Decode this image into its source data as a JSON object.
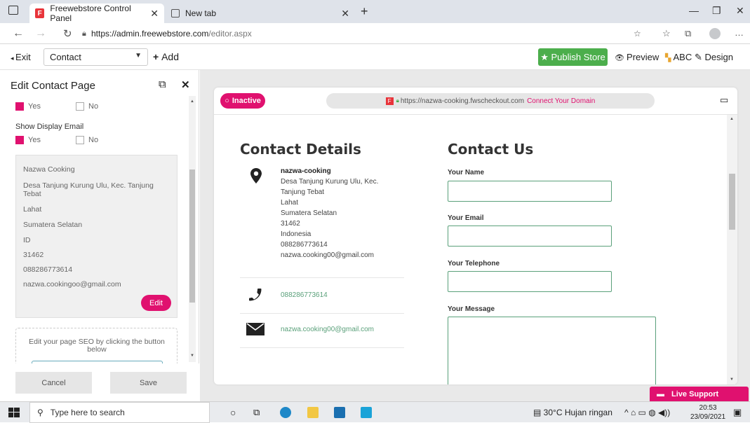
{
  "browser": {
    "tabs": [
      {
        "title": "Freewebstore Control Panel",
        "active": true
      },
      {
        "title": "New tab",
        "active": false
      }
    ],
    "url_host": "https://admin.freewebstore.com",
    "url_path": "/editor.aspx"
  },
  "toolbar": {
    "exit_label": "Exit",
    "page_select": "Contact",
    "add_label": "Add",
    "publish_label": "Publish Store",
    "preview_label": "Preview",
    "abc_label": "ABC",
    "design_label": "Design"
  },
  "left_panel": {
    "title": "Edit Contact Page",
    "yes_label": "Yes",
    "no_label": "No",
    "show_display_email": "Show Display Email",
    "address_card": [
      "Nazwa Cooking",
      "Desa Tanjung Kurung Ulu, Kec. Tanjung Tebat",
      "Lahat",
      "Sumatera Selatan",
      "ID",
      "31462",
      "088286773614",
      "nazwa.cookingoo@gmail.com"
    ],
    "edit_label": "Edit",
    "seo_text": "Edit your page SEO by clicking the button below",
    "cancel_label": "Cancel",
    "save_label": "Save"
  },
  "preview": {
    "status": "Inactive",
    "url": "https://nazwa-cooking.fwscheckout.com",
    "connect_domain": "Connect Your Domain",
    "contact_details_title": "Contact Details",
    "contact_us_title": "Contact Us",
    "address": {
      "name": "nazwa-cooking",
      "line1": "Desa Tanjung Kurung Ulu, Kec.",
      "line2": "Tanjung Tebat",
      "line3": "Lahat",
      "line4": "Sumatera Selatan",
      "line5": "31462",
      "line6": "Indonesia",
      "line7": "088286773614",
      "line8": "nazwa.cooking00@gmail.com"
    },
    "phone": "088286773614",
    "email": "nazwa.cooking00@gmail.com",
    "form": {
      "name_label": "Your Name",
      "email_label": "Your Email",
      "telephone_label": "Your Telephone",
      "message_label": "Your Message"
    },
    "live_support": "Live Support"
  },
  "taskbar": {
    "search_placeholder": "Type here to search",
    "weather": "30°C  Hujan ringan",
    "time": "20:53",
    "date": "23/09/2021"
  },
  "colors": {
    "accent": "#e0116f",
    "publish": "#4cae4c",
    "form_border": "#5aa07a"
  }
}
